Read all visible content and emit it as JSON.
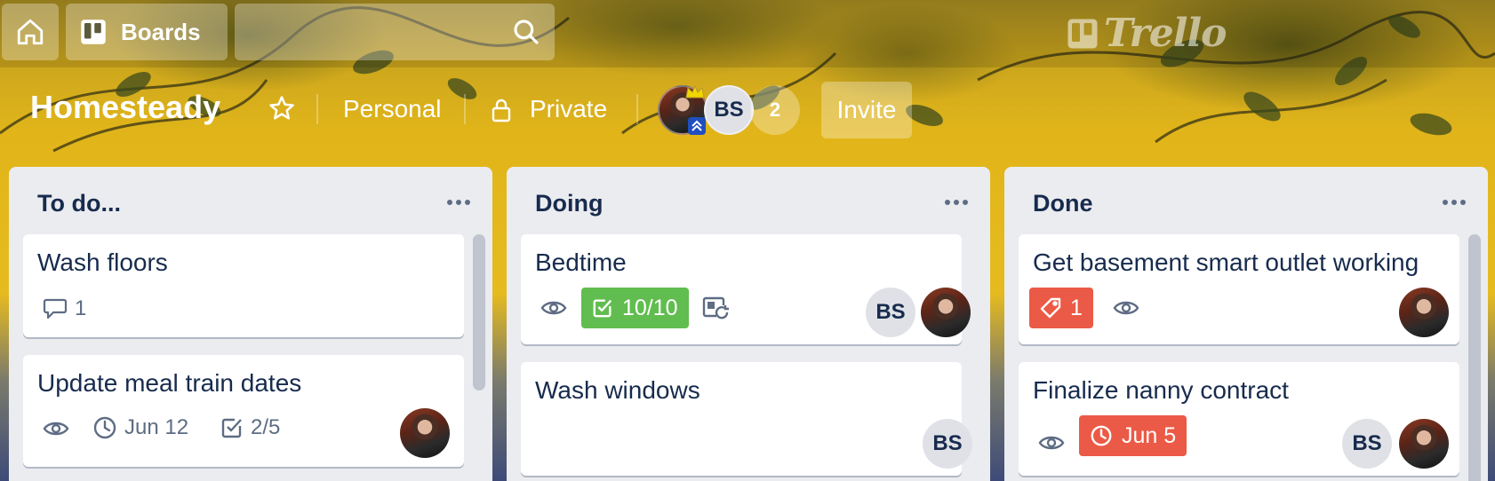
{
  "colors": {
    "list_bg": "#ebecf0",
    "card_bg": "#ffffff",
    "text_primary": "#172b4d",
    "text_muted": "#5e6c84",
    "badge_complete": "#61bd4f",
    "badge_overdue": "#eb5a46"
  },
  "topbar": {
    "home_icon": "home-icon",
    "boards_label": "Boards",
    "search_icon": "search-icon",
    "logo_text": "Trello"
  },
  "board": {
    "title": "Homesteady",
    "team_label": "Personal",
    "visibility_label": "Private",
    "member_initials": "BS",
    "extra_members_count": "2",
    "invite_label": "Invite"
  },
  "lists": [
    {
      "title": "To do...",
      "cards": [
        {
          "title": "Wash floors",
          "comments": "1"
        },
        {
          "title": "Update meal train dates",
          "due": "Jun 12",
          "checklist": "2/5"
        }
      ]
    },
    {
      "title": "Doing",
      "cards": [
        {
          "title": "Bedtime",
          "checklist": "10/10",
          "member_initials": "BS"
        },
        {
          "title": "Wash windows",
          "member_initials": "BS"
        }
      ]
    },
    {
      "title": "Done",
      "cards": [
        {
          "title": "Get basement smart outlet working",
          "label_count": "1"
        },
        {
          "title": "Finalize nanny contract",
          "due": "Jun 5",
          "member_initials": "BS"
        }
      ]
    }
  ]
}
